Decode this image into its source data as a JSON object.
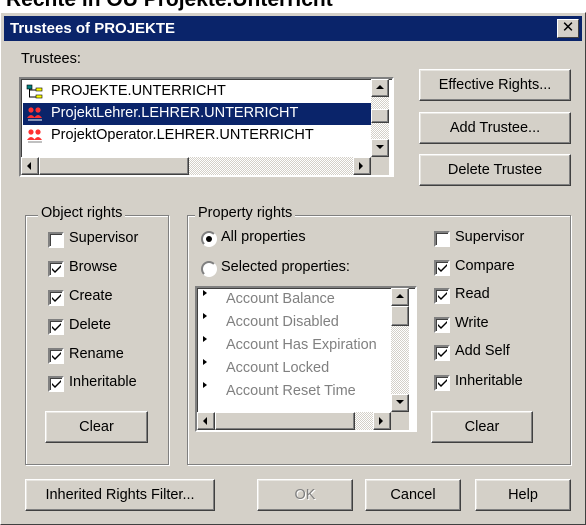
{
  "page": {
    "heading": "Rechte in OU Projekte.Unterricht"
  },
  "dialog": {
    "title": "Trustees of PROJEKTE",
    "close_glyph": "✕"
  },
  "trustees": {
    "label": "Trustees:",
    "items": [
      {
        "name": "PROJEKTE.UNTERRICHT",
        "icon": "org-unit-icon",
        "selected": false
      },
      {
        "name": "ProjektLehrer.LEHRER.UNTERRICHT",
        "icon": "group-icon",
        "selected": true
      },
      {
        "name": "ProjektOperator.LEHRER.UNTERRICHT",
        "icon": "group-icon",
        "selected": false
      }
    ]
  },
  "side_buttons": {
    "effective_rights": "Effective Rights...",
    "add_trustee": "Add Trustee...",
    "delete_trustee": "Delete Trustee"
  },
  "object_rights": {
    "title": "Object rights",
    "items": [
      {
        "label": "Supervisor",
        "checked": false
      },
      {
        "label": "Browse",
        "checked": true
      },
      {
        "label": "Create",
        "checked": true
      },
      {
        "label": "Delete",
        "checked": true
      },
      {
        "label": "Rename",
        "checked": true
      },
      {
        "label": "Inheritable",
        "checked": true
      }
    ],
    "clear": "Clear"
  },
  "property_rights": {
    "title": "Property rights",
    "all_properties": "All properties",
    "selected_properties": "Selected properties:",
    "mode": "all",
    "properties": [
      "Account Balance",
      "Account Disabled",
      "Account Has Expiration",
      "Account Locked",
      "Account Reset Time"
    ],
    "rights": [
      {
        "label": "Supervisor",
        "checked": false
      },
      {
        "label": "Compare",
        "checked": true
      },
      {
        "label": "Read",
        "checked": true
      },
      {
        "label": "Write",
        "checked": true
      },
      {
        "label": "Add Self",
        "checked": true
      },
      {
        "label": "Inheritable",
        "checked": true
      }
    ],
    "clear": "Clear"
  },
  "footer": {
    "inherited_rights_filter": "Inherited Rights Filter...",
    "ok": "OK",
    "cancel": "Cancel",
    "help": "Help"
  },
  "colors": {
    "dialog_face": "#d4d0c8",
    "titlebar": "#0a246a",
    "selection": "#0a246a",
    "disabled_text": "#808080"
  }
}
